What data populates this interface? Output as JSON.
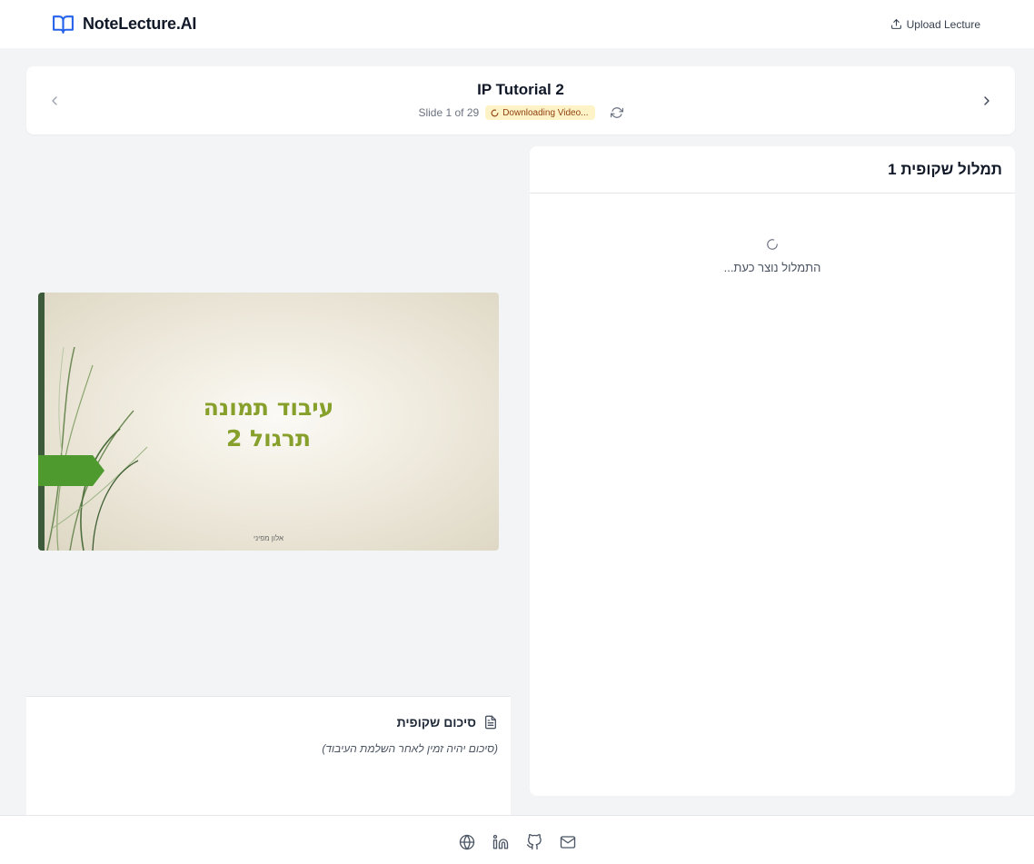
{
  "header": {
    "app_name": "NoteLecture.AI",
    "upload_label": "Upload Lecture"
  },
  "lecture": {
    "title": "IP Tutorial 2",
    "slide_counter": "Slide 1 of 29",
    "status": "Downloading Video...",
    "status_icon": "spinner-icon"
  },
  "slide": {
    "heading_line1": "עיבוד תמונה",
    "heading_line2": "תרגול 2",
    "author": "אלון מפיני"
  },
  "summary": {
    "title": "סיכום שקופית",
    "note": "(סיכום יהיה זמין לאחר השלמת העיבוד)"
  },
  "transcript": {
    "title": "תמלול שקופית 1",
    "loading_text": "התמלול נוצר כעת..."
  },
  "footer": {
    "icons": [
      "globe-icon",
      "linkedin-icon",
      "github-icon",
      "mail-icon"
    ]
  },
  "colors": {
    "brand_blue": "#2563eb",
    "badge_bg": "#fef3c7",
    "badge_text": "#92400e",
    "slide_title_green": "#86a02b",
    "slide_arrow_green": "#4e9a2e"
  }
}
